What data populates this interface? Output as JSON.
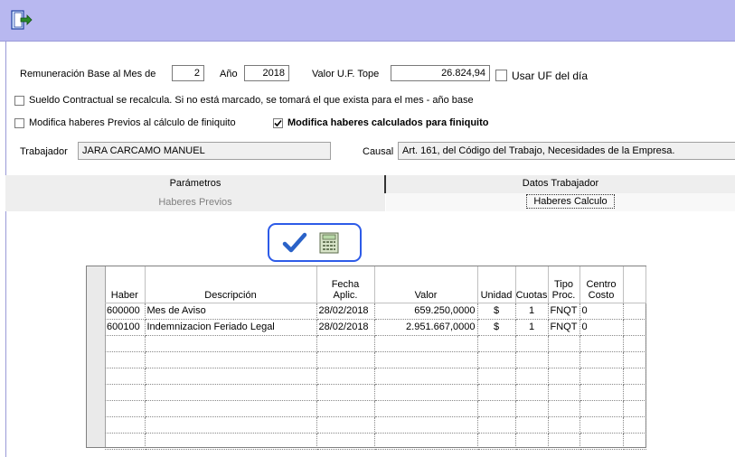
{
  "header": {
    "icon": "exit-door-icon"
  },
  "form": {
    "remuneracion_label": "Remuneración Base al Mes de",
    "mes_value": "2",
    "anio_label": "Año",
    "anio_value": "2018",
    "uf_tope_label": "Valor U.F. Tope",
    "uf_tope_value": "26.824,94",
    "usar_uf_label": "Usar UF del día",
    "usar_uf_checked": false,
    "sueldo_label": "Sueldo Contractual se recalcula. Si no está marcado, se tomará el que exista para el mes - año base",
    "sueldo_checked": false,
    "modifica_previos_label": "Modifica haberes Previos al cálculo de finiquito",
    "modifica_previos_checked": false,
    "modifica_calculados_label": "Modifica haberes calculados para finiquito",
    "modifica_calculados_checked": true,
    "trabajador_label": "Trabajador",
    "trabajador_value": "JARA CARCAMO MANUEL",
    "causal_label": "Causal",
    "causal_value": "Art. 161, del Código del Trabajo, Necesidades de la Empresa."
  },
  "tabs": {
    "parametros": "Parámetros",
    "datos_trabajador": "Datos Trabajador",
    "haberes_previos": "Haberes Previos",
    "haberes_calculo": "Haberes Calculo"
  },
  "toolbar": {
    "accept_icon": "checkmark-icon",
    "calc_icon": "calculator-icon"
  },
  "grid": {
    "headers": {
      "haber": "Haber",
      "descripcion": "Descripción",
      "fecha_1": "Fecha",
      "fecha_2": "Aplic.",
      "valor": "Valor",
      "unidad": "Unidad",
      "cuotas": "Cuotas",
      "tipo_1": "Tipo",
      "tipo_2": "Proc.",
      "centro_1": "Centro",
      "centro_2": "Costo"
    },
    "rows": [
      {
        "haber": "600000",
        "descripcion": "Mes de Aviso",
        "fecha": "28/02/2018",
        "valor": "659.250,0000",
        "unidad": "$",
        "cuotas": "1",
        "tipo": "FNQT",
        "centro": "0"
      },
      {
        "haber": "600100",
        "descripcion": "Indemnizacion Feriado Legal",
        "fecha": "28/02/2018",
        "valor": "2.951.667,0000",
        "unidad": "$",
        "cuotas": "1",
        "tipo": "FNQT",
        "centro": "0"
      }
    ]
  },
  "colors": {
    "titlebar": "#b8b8f0",
    "toolbar_border": "#2d5be8",
    "check": "#2a62c8"
  }
}
